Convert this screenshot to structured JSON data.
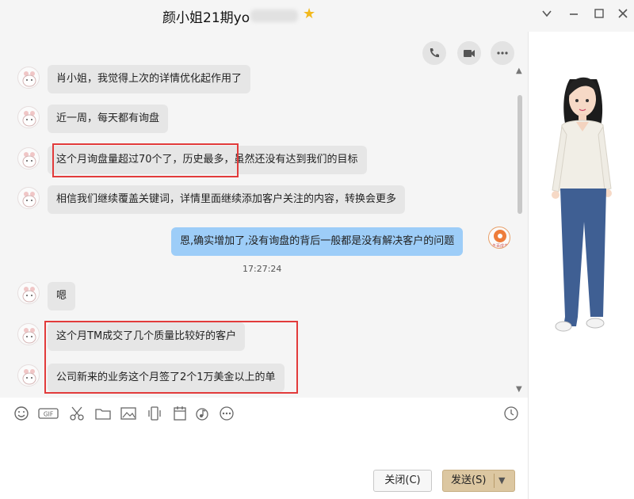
{
  "window": {
    "title": "颜小姐21期yo",
    "star_icon": "star-icon",
    "controls": [
      "chevron-down-icon",
      "minimize-icon",
      "maximize-icon",
      "close-icon"
    ]
  },
  "actions": [
    "phone-icon",
    "video-icon",
    "more-icon"
  ],
  "messages": [
    {
      "sender": "contact",
      "text": "肖小姐，我觉得上次的详情优化起作用了"
    },
    {
      "sender": "contact",
      "text": "近一周，每天都有询盘"
    },
    {
      "sender": "contact",
      "text": "这个月询盘量超过70个了，历史最多，虽然还没有达到我们的目标"
    },
    {
      "sender": "contact",
      "text": "相信我们继续覆盖关键词，详情里面继续添加客户关注的内容，转换会更多"
    },
    {
      "sender": "me",
      "text": "恩,确实增加了,没有询盘的背后一般都是没有解决客户的问题"
    },
    {
      "sender": "contact",
      "text": "嗯"
    },
    {
      "sender": "contact",
      "text": "这个月TM成交了几个质量比较好的客户"
    },
    {
      "sender": "contact",
      "text": "公司新来的业务这个月签了2个1万美金以上的单"
    }
  ],
  "my_avatar_label": "冬百成多",
  "timestamp": "17:27:24",
  "toolbar_tools": [
    "emoji-icon",
    "gif-icon",
    "scissors-icon",
    "folder-icon",
    "image-icon",
    "shake-icon",
    "calendar-icon",
    "music-icon",
    "more-tools-icon",
    "history-clock-icon"
  ],
  "buttons": {
    "close": "关闭(C)",
    "send": "发送(S)"
  },
  "colors": {
    "my_bubble": "#9dcdf8",
    "contact_bubble": "#e6e6e6",
    "highlight": "#e23b3b",
    "send_button": "#dcc7a1"
  }
}
